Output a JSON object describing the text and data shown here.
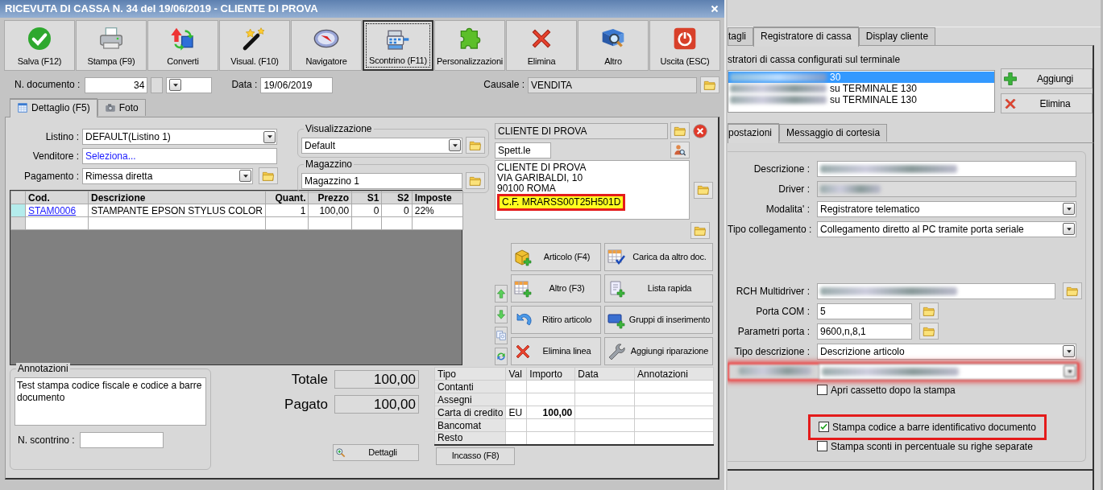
{
  "main_window": {
    "title": "RICEVUTA DI CASSA N. 34 del 19/06/2019 - CLIENTE DI PROVA",
    "toolbar": [
      {
        "label": "Salva (F12)",
        "selected": false
      },
      {
        "label": "Stampa (F9)",
        "selected": false
      },
      {
        "label": "Converti",
        "selected": false
      },
      {
        "label": "Visual. (F10)",
        "selected": false
      },
      {
        "label": "Navigatore",
        "selected": false
      },
      {
        "label": "Scontrino (F11)",
        "selected": true
      },
      {
        "label": "Personalizzazioni",
        "selected": false
      },
      {
        "label": "Elimina",
        "selected": false
      },
      {
        "label": "Altro",
        "selected": false
      },
      {
        "label": "Uscita (ESC)",
        "selected": false
      }
    ],
    "document": {
      "number_label": "N. documento :",
      "number": "34",
      "date_label": "Data :",
      "date": "19/06/2019",
      "reason_label": "Causale :",
      "reason": "VENDITA"
    },
    "tabs": [
      {
        "label": "Dettaglio (F5)",
        "selected": true
      },
      {
        "label": "Foto",
        "selected": false
      }
    ],
    "fields": [
      {
        "label": "Listino :",
        "value": "DEFAULT(Listino 1)",
        "kind": "select"
      },
      {
        "label": "Venditore :",
        "value": "Seleziona...",
        "kind": "link"
      },
      {
        "label": "Pagamento :",
        "value": "Rimessa diretta",
        "kind": "select_folder"
      }
    ],
    "groups": [
      {
        "legend": "Visualizzazione",
        "value": "Default",
        "kind": "select"
      },
      {
        "legend": "Magazzino",
        "value": "Magazzino 1",
        "kind": "text"
      }
    ],
    "customer": {
      "name": "CLIENTE DI PROVA",
      "salutation": "Spett.le",
      "address": [
        "CLIENTE DI PROVA",
        "VIA GARIBALDI, 10",
        "90100 ROMA"
      ],
      "tax_code": "C.F. MRARSS00T25H501D",
      "tax_code_highlighted": true
    },
    "grid": {
      "columns": [
        "Cod.",
        "Descrizione",
        "Quant.",
        "Prezzo",
        "S1",
        "S2",
        "Imposte"
      ],
      "rows": [
        {
          "cells": [
            "STAM0006",
            "STAMPANTE EPSON STYLUS COLOR",
            "1",
            "100,00",
            "0",
            "0",
            "22%"
          ],
          "selected": true
        }
      ]
    },
    "actions": [
      "Articolo (F4)",
      "Carica da altro doc.",
      "Altro (F3)",
      "Lista rapida",
      "Ritiro articolo",
      "Gruppi di inserimento",
      "Elimina linea",
      "Aggiungi riparazione"
    ],
    "notes": {
      "legend": "Annotazioni",
      "text": "Test stampa codice fiscale e codice a barre documento",
      "receipt_label": "N. scontrino :"
    },
    "totals": [
      {
        "label": "Totale",
        "value": "100,00"
      },
      {
        "label": "Pagato",
        "value": "100,00"
      }
    ],
    "details_button": "Dettagli",
    "payments": {
      "columns": [
        "Tipo",
        "Val",
        "Importo",
        "Data",
        "Annotazioni"
      ],
      "rows": [
        [
          "Contanti"
        ],
        [
          "Assegni"
        ],
        [
          "Carta di credito",
          "EU",
          "100,00"
        ],
        [
          "Bancomat"
        ],
        [
          "Resto"
        ]
      ]
    },
    "collect_button": "Incasso (F8)"
  },
  "settings_window": {
    "tabs": [
      {
        "label": "tagli",
        "selected": false
      },
      {
        "label": "Registratore di cassa",
        "selected": true
      },
      {
        "label": "Display cliente",
        "selected": false
      }
    ],
    "list_caption": "stratori di cassa configurati sul terminale",
    "registers": [
      {
        "text": "30",
        "selected": true
      },
      {
        "text": "su TERMINALE 130",
        "selected": false
      },
      {
        "text": "su TERMINALE 130",
        "selected": false
      }
    ],
    "buttons": [
      "Aggiungi",
      "Elimina"
    ],
    "subtabs": [
      {
        "label": "postazioni",
        "selected": true
      },
      {
        "label": "Messaggio di cortesia",
        "selected": false
      }
    ],
    "connection_fields": [
      {
        "label": "Descrizione :",
        "kind": "text",
        "redacted": true
      },
      {
        "label": "Driver :",
        "kind": "readonly",
        "redacted": true
      },
      {
        "label": "Modalita' :",
        "kind": "select",
        "value": "Registratore telematico"
      },
      {
        "label": "Tipo collegamento :",
        "kind": "select",
        "value": "Collegamento diretto al PC tramite porta seriale"
      }
    ],
    "port_fields": [
      {
        "label": "RCH Multidriver :",
        "kind": "text_folder",
        "redacted": true
      },
      {
        "label": "Porta COM :",
        "kind": "short_folder",
        "value": "5"
      },
      {
        "label": "Parametri porta :",
        "kind": "short_folder",
        "value": "9600,n,8,1"
      },
      {
        "label": "Tipo descrizione :",
        "kind": "select",
        "value": "Descrizione articolo"
      },
      {
        "kind": "select",
        "redacted": true,
        "label_redacted": true,
        "highlighted": true
      }
    ],
    "checkboxes": [
      {
        "label": "Apri cassetto dopo la stampa",
        "checked": false,
        "highlighted": false
      },
      {
        "label": "Stampa codice a barre identificativo documento",
        "checked": true,
        "highlighted": true
      },
      {
        "label": "Stampa sconti in percentuale su righe separate",
        "checked": false,
        "highlighted": false
      }
    ]
  }
}
